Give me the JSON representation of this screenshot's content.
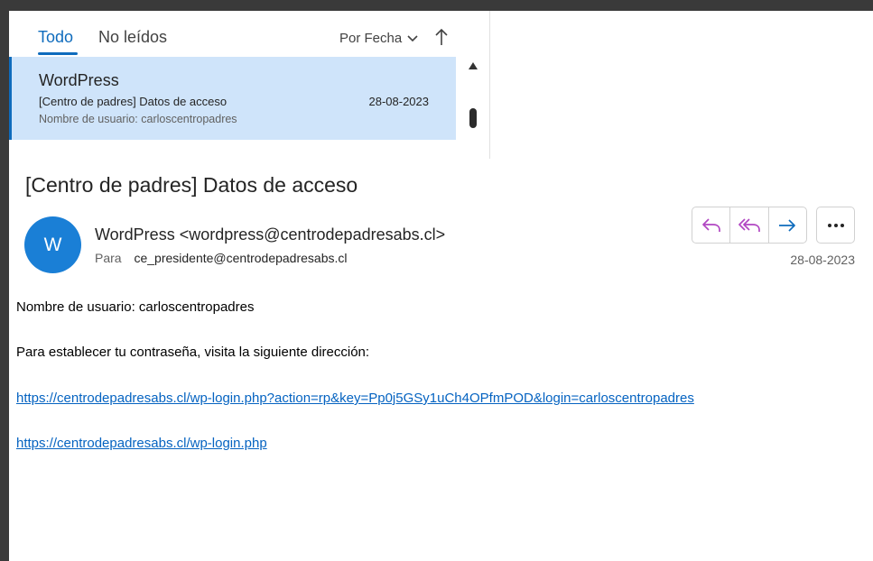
{
  "list": {
    "tabs": [
      {
        "label": "Todo",
        "active": true
      },
      {
        "label": "No leídos",
        "active": false
      }
    ],
    "sort_label": "Por Fecha",
    "items": [
      {
        "sender": "WordPress",
        "subject": "[Centro de padres] Datos de acceso",
        "date": "28-08-2023",
        "preview": "Nombre de usuario: carloscentropadres"
      }
    ]
  },
  "message": {
    "subject": "[Centro de padres] Datos de acceso",
    "avatar_initial": "W",
    "from": "WordPress <wordpress@centrodepadresabs.cl>",
    "to_label": "Para",
    "to": "ce_presidente@centrodepadresabs.cl",
    "date": "28-08-2023",
    "body": {
      "username_line": "Nombre de usuario: carloscentropadres",
      "instruction": "Para establecer tu contraseña, visita la siguiente dirección:",
      "reset_link": "https://centrodepadresabs.cl/wp-login.php?action=rp&key=Pp0j5GSy1uCh4OPfmPOD&login=carloscentropadres",
      "login_link": "https://centrodepadresabs.cl/wp-login.php"
    }
  },
  "colors": {
    "accent": "#0f6cbd",
    "selected_bg": "#cfe4fa",
    "avatar_bg": "#1a7fd6",
    "action_icon": "#b146c2",
    "forward_icon": "#0f6cbd",
    "link": "#0563c1"
  },
  "icons": {
    "reply": "reply-icon",
    "reply_all": "reply-all-icon",
    "forward": "forward-icon",
    "more": "more-icon",
    "sort_chevron": "chevron-down-icon",
    "sort_direction": "arrow-up-icon"
  }
}
